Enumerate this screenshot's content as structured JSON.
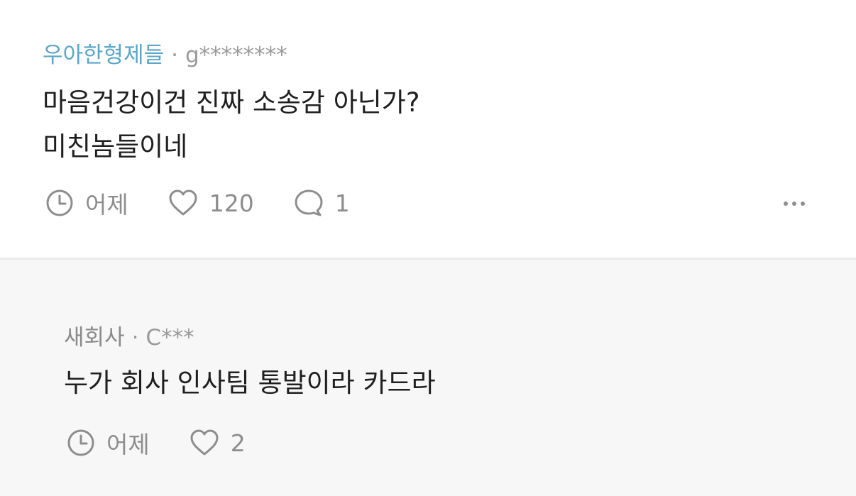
{
  "comment": {
    "company": "우아한형제들",
    "separator": "·",
    "author": "g********",
    "lines": [
      "마음건강이건 진짜 소송감 아닌가?",
      "미친놈들이네"
    ],
    "time": "어제",
    "likes": "120",
    "replies": "1",
    "accent_color": "#5aa6c8"
  },
  "reply": {
    "company": "새회사",
    "separator": "·",
    "author": "C***",
    "lines": [
      "누가 회사 인사팀 통발이라 카드라"
    ],
    "time": "어제",
    "likes": "2"
  },
  "icons": {
    "time": "clock-icon",
    "like": "heart-icon",
    "reply": "speech-bubble-icon",
    "more": "more-horizontal-icon"
  }
}
